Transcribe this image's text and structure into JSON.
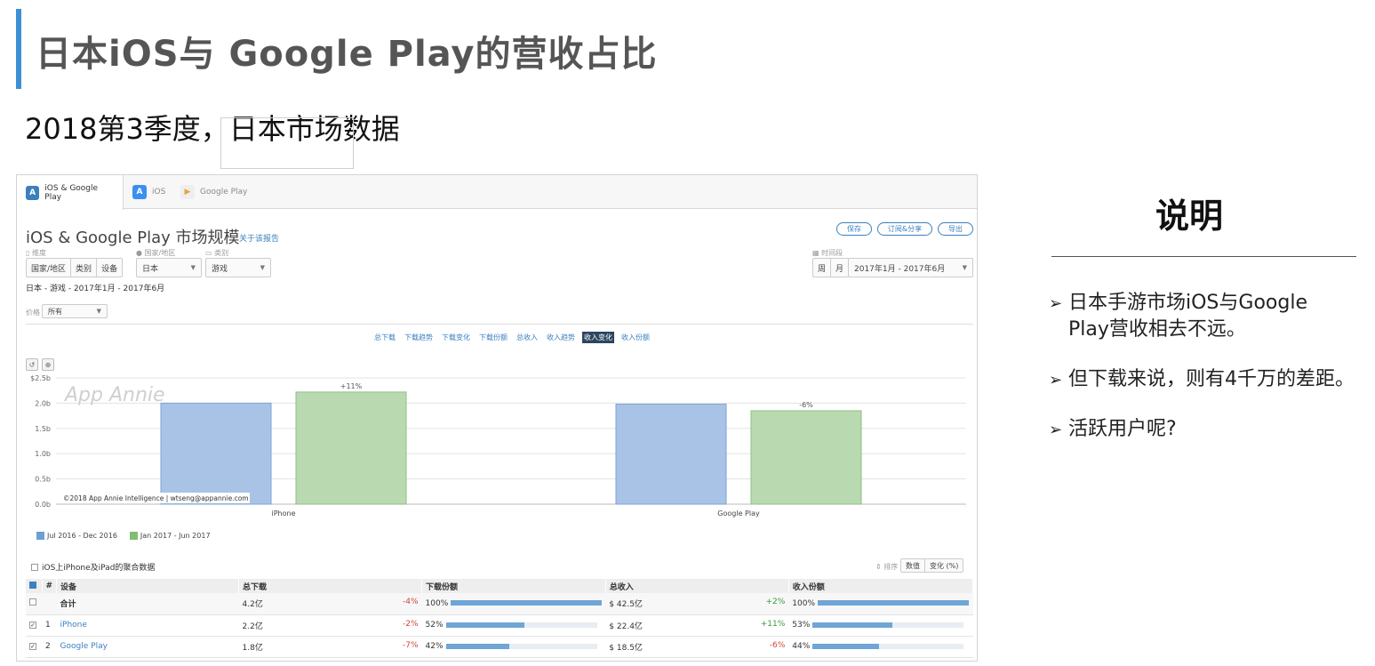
{
  "slide": {
    "title": "日本iOS与 Google Play的营收占比",
    "subtitle": "2018第3季度，日本市场数据"
  },
  "screenshot": {
    "tabs": [
      {
        "label": "iOS & Google Play",
        "icon": "appannie-icon"
      },
      {
        "label": "iOS",
        "icon": "app-store-icon"
      },
      {
        "label": "Google Play",
        "icon": "google-play-icon"
      }
    ],
    "page_title": "iOS & Google Play 市场规模",
    "about_link": "关于该报告",
    "actions": {
      "save": "保存",
      "subscribe": "订阅&分享",
      "export": "导出"
    },
    "filters": {
      "dimension_label": "维度",
      "dimension_options": [
        "国家/地区",
        "类别",
        "设备"
      ],
      "country_label": "国家/地区",
      "country_value": "日本",
      "category_label": "类别",
      "category_value": "游戏",
      "period_label": "时间段",
      "period_options": [
        "周",
        "月"
      ],
      "period_value": "2017年1月 - 2017年6月"
    },
    "breadcrumb": "日本 - 游戏 - 2017年1月 - 2017年6月",
    "price": {
      "label": "价格",
      "value": "所有"
    },
    "subtabs": [
      "总下载",
      "下载趋势",
      "下载变化",
      "下载份额",
      "总收入",
      "收入趋势",
      "收入变化",
      "收入份额"
    ],
    "active_subtab": "收入变化",
    "watermark": "App Annie",
    "copyright": "©2018 App Annie Intelligence | wtseng@appannie.com",
    "aggregate_checkbox": "iOS上iPhone及iPad的聚合数据",
    "sort": {
      "label": "排序",
      "options": [
        "数值",
        "变化 (%)"
      ]
    },
    "table": {
      "headers": [
        "#",
        "设备",
        "总下载",
        "下载份额",
        "总收入",
        "收入份额"
      ],
      "rows": [
        {
          "num": "",
          "device": "合计",
          "downloads": "4.2亿",
          "dl_change": "-4%",
          "dl_share": "100",
          "dl_share_frac": 1.0,
          "revenue": "42.5亿",
          "rev_change": "+2%",
          "rev_share": "100",
          "rev_share_frac": 1.0
        },
        {
          "num": "1",
          "device": "iPhone",
          "downloads": "2.2亿",
          "dl_change": "-2%",
          "dl_share": "52",
          "dl_share_frac": 0.52,
          "revenue": "22.4亿",
          "rev_change": "+11%",
          "rev_share": "53",
          "rev_share_frac": 0.53
        },
        {
          "num": "2",
          "device": "Google Play",
          "downloads": "1.8亿",
          "dl_change": "-7%",
          "dl_share": "42",
          "dl_share_frac": 0.42,
          "revenue": "18.5亿",
          "rev_change": "-6%",
          "rev_share": "44",
          "rev_share_frac": 0.44
        }
      ]
    }
  },
  "chart_data": {
    "type": "bar",
    "categories": [
      "iPhone",
      "Google Play"
    ],
    "series": [
      {
        "name": "Jul 2016 - Dec 2016",
        "values": [
          2.0,
          1.98
        ],
        "color": "#a9c3e6"
      },
      {
        "name": "Jan 2017 - Jun 2017",
        "values": [
          2.22,
          1.85
        ],
        "color": "#b9dab1"
      }
    ],
    "data_labels": [
      "",
      "+11%",
      "",
      "-6%"
    ],
    "ytick_labels": [
      "0.0b",
      "0.5b",
      "1.0b",
      "1.5b",
      "2.0b",
      "$2.5b"
    ],
    "ylim": [
      0,
      2.5
    ],
    "grid": true,
    "legend": "bottom-left"
  },
  "notes": {
    "title": "说明",
    "bullets": [
      {
        "line1": "日本手游市场iOS与Google",
        "line2": "Play营收相去不远。"
      },
      {
        "line1": "但下载来说，则有4千万的差距。"
      },
      {
        "line1": "活跃用户呢?"
      }
    ],
    "bullet_marker": "➢"
  }
}
